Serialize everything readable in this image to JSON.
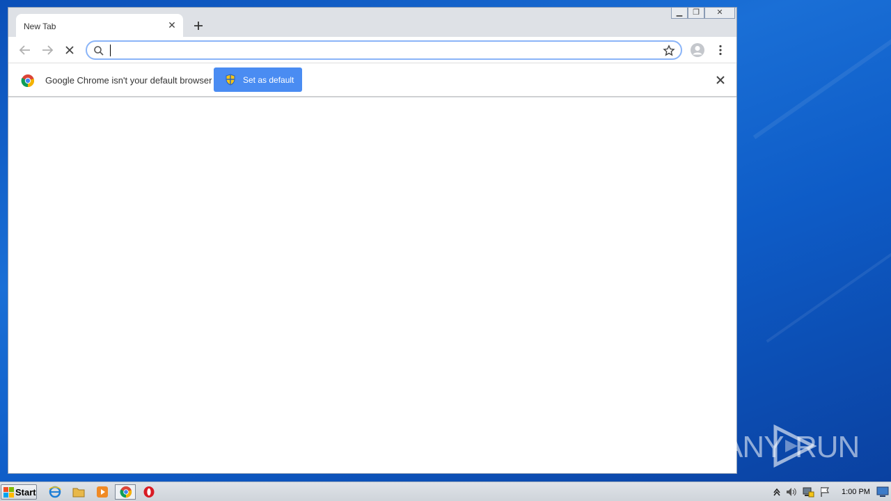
{
  "browser": {
    "tab": {
      "title": "New Tab",
      "close_icon": "close-icon"
    },
    "new_tab_icon": "plus-icon",
    "window_controls": [
      "minimize-icon",
      "restore-icon",
      "close-icon"
    ],
    "toolbar": {
      "back_icon": "arrow-left-icon",
      "forward_icon": "arrow-right-icon",
      "stop_icon": "stop-icon",
      "omnibox": {
        "value": "",
        "placeholder": "",
        "search_icon": "search-icon",
        "bookmark_icon": "star-icon"
      },
      "profile_icon": "avatar-icon",
      "menu_icon": "kebab-menu-icon"
    },
    "infobar": {
      "logo": "chrome-logo-icon",
      "message": "Google Chrome isn't your default browser",
      "button_label": "Set as default",
      "button_icon": "uac-shield-icon",
      "close_icon": "close-icon"
    }
  },
  "watermark": {
    "left": "ANY",
    "right": "RUN",
    "logo": "play-triangle-icon"
  },
  "taskbar": {
    "start_label": "Start",
    "pinned": [
      "internet-explorer-icon",
      "file-explorer-icon",
      "media-player-icon",
      "chrome-icon",
      "opera-icon"
    ],
    "tray": [
      "show-hidden-icons-icon",
      "volume-icon",
      "network-icon",
      "action-center-flag-icon"
    ],
    "clock": "1:00 PM"
  },
  "colors": {
    "desktop": "#0e5cc7",
    "accent_button": "#4a8cf2",
    "omnibox_focus": "#8ab4f8"
  }
}
